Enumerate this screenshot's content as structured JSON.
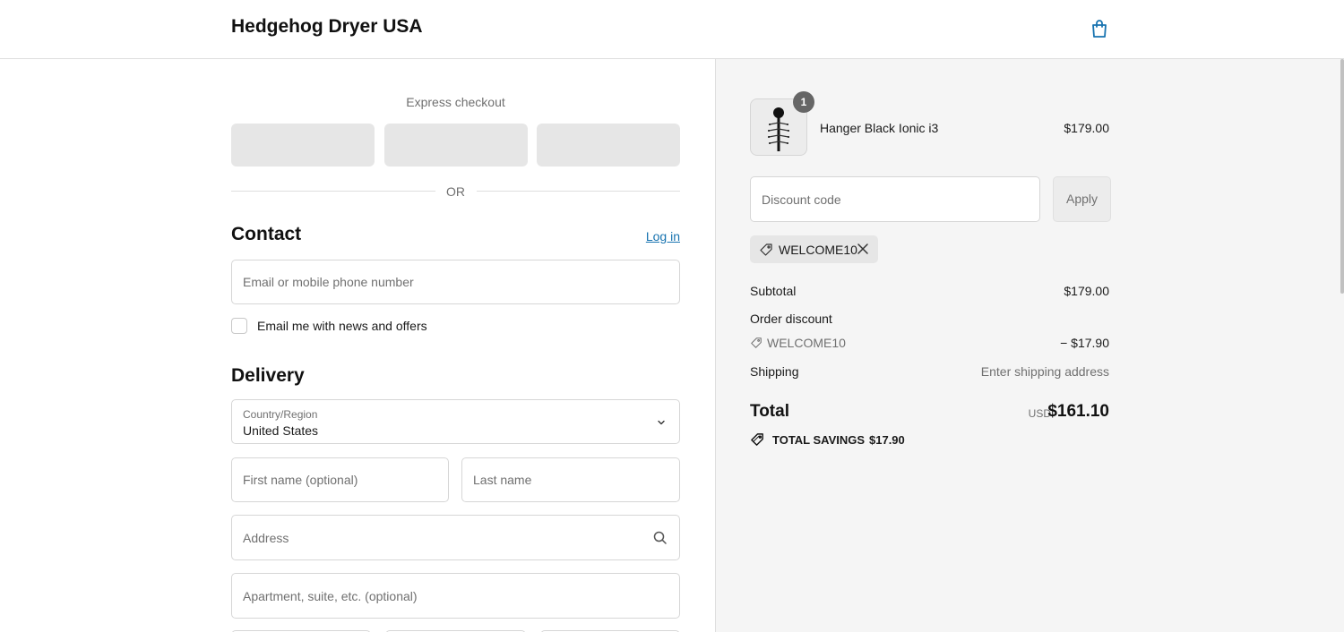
{
  "header": {
    "store_name": "Hedgehog Dryer USA",
    "cart_icon": "shopping-bag-icon"
  },
  "express": {
    "label": "Express checkout",
    "or_label": "OR"
  },
  "contact": {
    "title": "Contact",
    "login_label": "Log in",
    "email_placeholder": "Email or mobile phone number",
    "newsletter_label": "Email me with news and offers",
    "newsletter_checked": false
  },
  "delivery": {
    "title": "Delivery",
    "country_label": "Country/Region",
    "country_value": "United States",
    "first_name_placeholder": "First name (optional)",
    "last_name_placeholder": "Last name",
    "address_placeholder": "Address",
    "apartment_placeholder": "Apartment, suite, etc. (optional)"
  },
  "order": {
    "item": {
      "name": "Hanger Black Ionic i3",
      "price": "$179.00",
      "quantity": "1"
    },
    "discount_placeholder": "Discount code",
    "apply_label": "Apply",
    "applied_code": "WELCOME10",
    "subtotal_label": "Subtotal",
    "subtotal_value": "$179.00",
    "order_discount_label": "Order discount",
    "discount_code": "WELCOME10",
    "discount_value": "− $17.90",
    "shipping_label": "Shipping",
    "shipping_value": "Enter shipping address",
    "total_label": "Total",
    "total_currency": "USD",
    "total_value": "$161.10",
    "savings_label": "TOTAL SAVINGS",
    "savings_value": "$17.90"
  },
  "colors": {
    "link": "#1773b0",
    "summary_bg": "#f5f5f5",
    "border": "#d6d6d6"
  }
}
